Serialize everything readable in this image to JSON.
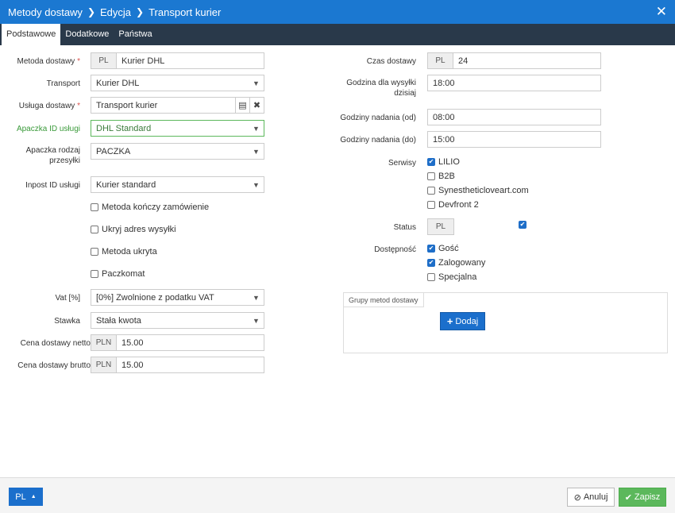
{
  "title": {
    "crumb1": "Metody dostawy",
    "crumb2": "Edycja",
    "crumb3": "Transport kurier",
    "sep": "❯",
    "close": "✕"
  },
  "tabs": [
    "Podstawowe",
    "Dodatkowe",
    "Państwa"
  ],
  "left": {
    "metoda": {
      "label": "Metoda dostawy",
      "req": "*",
      "addon": "PL",
      "value": "Kurier DHL"
    },
    "transport": {
      "label": "Transport",
      "value": "Kurier DHL"
    },
    "usluga": {
      "label": "Usługa dostawy",
      "req": "*",
      "value": "Transport kurier"
    },
    "apaczka_id": {
      "label": "Apaczka ID usługi",
      "value": "DHL Standard"
    },
    "apaczka_rodzaj": {
      "label1": "Apaczka rodzaj",
      "label2": "przesyłki",
      "value": "PACZKA"
    },
    "inpost": {
      "label": "Inpost ID usługi",
      "value": "Kurier standard"
    },
    "checks": [
      "Metoda kończy zamówienie",
      "Ukryj adres wysyłki",
      "Metoda ukryta",
      "Paczkomat"
    ],
    "vat": {
      "label": "Vat [%]",
      "value": "[0%] Zwolnione z podatku VAT"
    },
    "stawka": {
      "label": "Stawka",
      "value": "Stała kwota"
    },
    "netto": {
      "label": "Cena dostawy netto",
      "addon": "PLN",
      "value": "15.00"
    },
    "brutto": {
      "label": "Cena dostawy brutto",
      "addon": "PLN",
      "value": "15.00"
    }
  },
  "right": {
    "czas": {
      "label": "Czas dostawy",
      "addon": "PL",
      "value": "24"
    },
    "godzina": {
      "label1": "Godzina dla wysyłki",
      "label2": "dzisiaj",
      "value": "18:00"
    },
    "od": {
      "label": "Godziny nadania (od)",
      "value": "08:00"
    },
    "do": {
      "label": "Godziny nadania (do)",
      "value": "15:00"
    },
    "serwisy": {
      "label": "Serwisy",
      "items": [
        {
          "name": "LILIO",
          "checked": true
        },
        {
          "name": "B2B",
          "checked": false
        },
        {
          "name": "Synestheticloveart.com",
          "checked": false
        },
        {
          "name": "Devfront 2",
          "checked": false
        }
      ]
    },
    "status": {
      "label": "Status",
      "addon": "PL",
      "checked": true
    },
    "dostepnosc": {
      "label": "Dostępność",
      "items": [
        {
          "name": "Gość",
          "checked": true
        },
        {
          "name": "Zalogowany",
          "checked": true
        },
        {
          "name": "Specjalna",
          "checked": false
        }
      ]
    },
    "grupy": {
      "legend": "Grupy metod dostawy",
      "add": "Dodaj"
    }
  },
  "footer": {
    "lang": "PL",
    "cancel": "Anuluj",
    "save": "Zapisz"
  },
  "colors": {
    "primary": "#1b78d1",
    "tabbar": "#29394a",
    "success": "#5cb85c",
    "required": "#d9534f"
  }
}
